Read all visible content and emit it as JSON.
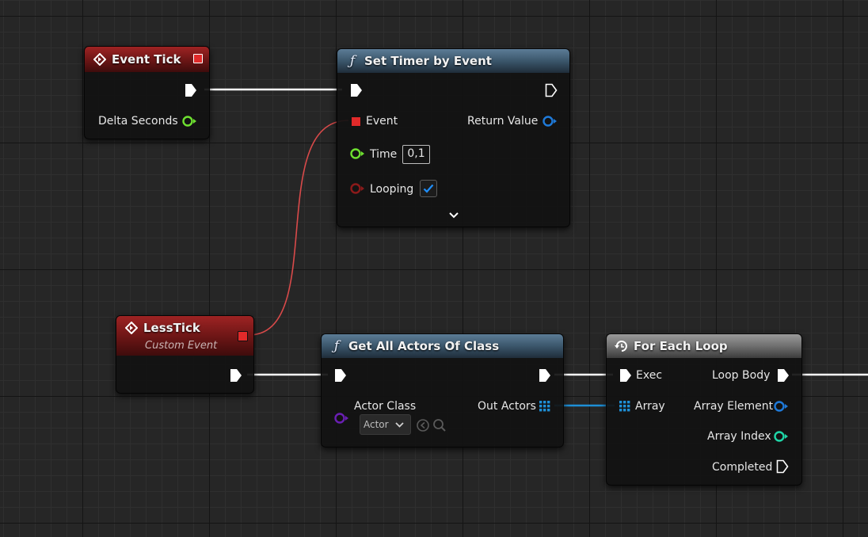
{
  "nodes": {
    "event_tick": {
      "title": "Event Tick",
      "pins": {
        "delta_seconds": "Delta Seconds"
      }
    },
    "set_timer": {
      "title": "Set Timer by Event",
      "pins": {
        "event": "Event",
        "return_value": "Return Value",
        "time": "Time",
        "time_value": "0,1",
        "looping": "Looping"
      },
      "looping_checked": true
    },
    "less_tick": {
      "title": "LessTick",
      "subtitle": "Custom Event"
    },
    "get_all_actors": {
      "title": "Get All Actors Of Class",
      "pins": {
        "actor_class": "Actor Class",
        "actor_class_value": "Actor",
        "out_actors": "Out Actors"
      }
    },
    "for_each": {
      "title": "For Each Loop",
      "pins": {
        "exec": "Exec",
        "loop_body": "Loop Body",
        "array": "Array",
        "array_element": "Array Element",
        "array_index": "Array Index",
        "completed": "Completed"
      }
    }
  },
  "colors": {
    "exec_wire": "#ffffff",
    "delegate_wire": "#d94a4a",
    "array_wire": "#1e8fd6",
    "float_pin": "#6ee030",
    "bool_pin": "#8c1a1a",
    "object_pin": "#1f7ad9",
    "class_pin": "#6a1fb3",
    "int_pin": "#1fd6a8"
  }
}
